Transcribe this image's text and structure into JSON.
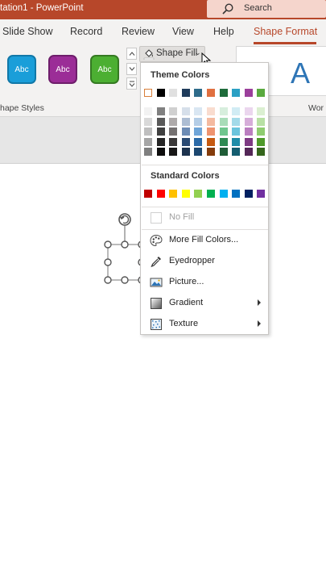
{
  "window": {
    "title": "tation1 - PowerPoint"
  },
  "search": {
    "placeholder": "Search"
  },
  "ribbon_tabs": [
    {
      "label": "Slide Show"
    },
    {
      "label": "Record"
    },
    {
      "label": "Review"
    },
    {
      "label": "View"
    },
    {
      "label": "Help"
    },
    {
      "label": "Shape Format",
      "active": true
    }
  ],
  "shape_styles": {
    "group_label": "hape Styles",
    "items": [
      {
        "label": "Abc",
        "fill": "#1a9ed9",
        "border": "#1178a8"
      },
      {
        "label": "Abc",
        "fill": "#9b2d97",
        "border": "#6e1e6b"
      },
      {
        "label": "Abc",
        "fill": "#4caf32",
        "border": "#357a22"
      }
    ]
  },
  "wordart": {
    "group_label": "Wor",
    "letter": "A"
  },
  "shape_fill": {
    "label": "Shape Fill",
    "icon": "paint-bucket-icon"
  },
  "menu": {
    "theme_colors_heading": "Theme Colors",
    "theme_base": [
      "#ffffff",
      "#000000",
      "#e7e6e6",
      "#44546a",
      "#4472c4",
      "#ed7d31",
      "#a5a5a5",
      "#ffc000",
      "#5b9bd5",
      "#70ad47"
    ],
    "theme_base_display": [
      "#ffffff",
      "#000000",
      "#e0e0e0",
      "#1f3b5b",
      "#2e6b8a",
      "#e07040",
      "#1e6b3a",
      "#2ba0c4",
      "#9b3f9b",
      "#5aaa3f"
    ],
    "theme_shades": [
      [
        "#f2f2f2",
        "#808080",
        "#d0d0d0",
        "#d6dfea",
        "#d9e6f2",
        "#f9dccf",
        "#d7eedd",
        "#d1ecf4",
        "#ebd6ee",
        "#dbefd1"
      ],
      [
        "#d9d9d9",
        "#595959",
        "#aeaaaa",
        "#adbdd3",
        "#b4cde6",
        "#f4baa0",
        "#a8dcb8",
        "#a3dae9",
        "#d6add9",
        "#b8e0a4"
      ],
      [
        "#bfbfbf",
        "#404040",
        "#757171",
        "#6d8cb5",
        "#6fa5d8",
        "#ee9470",
        "#6fc68e",
        "#6bc4dd",
        "#bb7ec0",
        "#8fcc70"
      ],
      [
        "#a6a6a6",
        "#262626",
        "#3a3838",
        "#2a4a73",
        "#2b6aa8",
        "#c55a11",
        "#2e8a52",
        "#1f8ca8",
        "#7e3a83",
        "#4f9a2a"
      ],
      [
        "#7f7f7f",
        "#0d0d0d",
        "#171616",
        "#1c324d",
        "#1c4770",
        "#843c0c",
        "#1f5c37",
        "#145d70",
        "#542757",
        "#35661c"
      ]
    ],
    "standard_colors_heading": "Standard Colors",
    "standard_colors": [
      "#c00000",
      "#ff0000",
      "#ffc000",
      "#ffff00",
      "#92d050",
      "#00b050",
      "#00b0f0",
      "#0070c0",
      "#002060",
      "#7030a0"
    ],
    "items": [
      {
        "label": "No Fill",
        "name": "no-fill",
        "disabled": true
      },
      {
        "label": "More Fill Colors...",
        "name": "more-fill-colors",
        "icon": "palette-icon"
      },
      {
        "label": "Eyedropper",
        "name": "eyedropper",
        "icon": "eyedropper-icon"
      },
      {
        "label": "Picture...",
        "name": "picture",
        "icon": "picture-icon"
      },
      {
        "label": "Gradient",
        "name": "gradient",
        "icon": "gradient-icon",
        "submenu": true
      },
      {
        "label": "Texture",
        "name": "texture",
        "icon": "texture-icon",
        "submenu": true
      }
    ]
  },
  "colors": {
    "accent": "#b7472a",
    "search_bg": "#f5d5cc",
    "ribbon_bg": "#f3f2f1"
  }
}
